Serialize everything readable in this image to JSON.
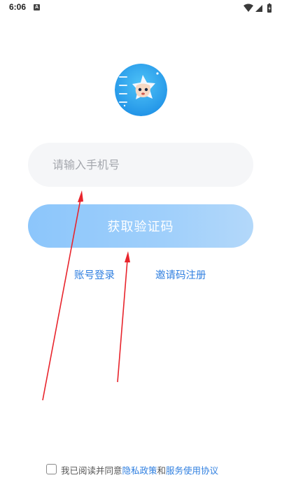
{
  "status_bar": {
    "time": "6:06",
    "notification_letter": "A"
  },
  "login": {
    "phone_placeholder": "请输入手机号",
    "get_code_label": "获取验证码",
    "account_login_label": "账号登录",
    "invite_register_label": "邀请码注册"
  },
  "agreement": {
    "text_before": "我已阅读并同意",
    "privacy_label": "隐私政策",
    "and_text": "和",
    "service_label": "服务使用协议"
  },
  "colors": {
    "accent": "#2f7fe0",
    "button_gradient_start": "#8cc6fb",
    "annotation_arrow": "#e8242c"
  },
  "icons": [
    "notification-a-icon",
    "wifi-icon",
    "signal-icon",
    "battery-icon",
    "app-logo",
    "arrow-annotation"
  ]
}
